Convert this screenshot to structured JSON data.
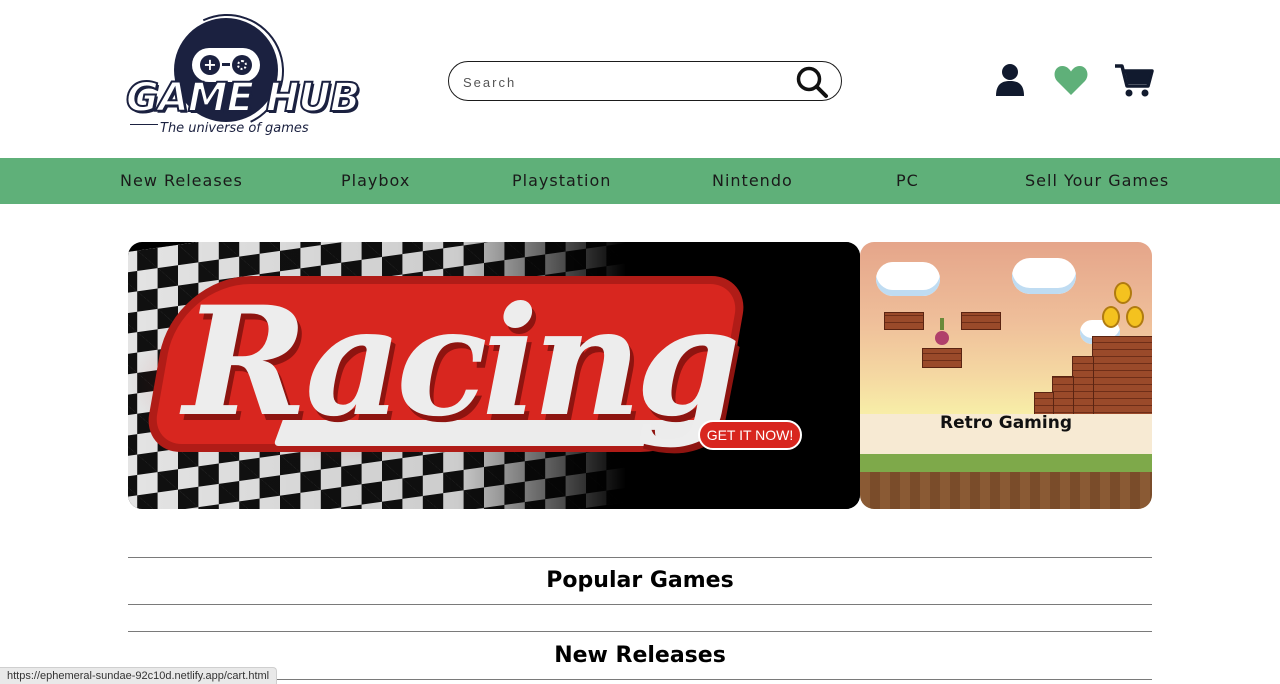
{
  "header": {
    "logo": {
      "title": "GAME HUB",
      "tagline": "The universe of games"
    },
    "search": {
      "placeholder": "Search",
      "value": ""
    },
    "icons": {
      "account": "user-icon",
      "wishlist": "heart-icon",
      "cart": "cart-icon"
    }
  },
  "nav": {
    "items": [
      {
        "label": "New Releases"
      },
      {
        "label": "Playbox"
      },
      {
        "label": "Playstation"
      },
      {
        "label": "Nintendo"
      },
      {
        "label": "PC"
      },
      {
        "label": "Sell Your Games"
      }
    ]
  },
  "banners": {
    "main": {
      "title": "Racing",
      "cta_label": "GET IT NOW!"
    },
    "side": {
      "label": "Retro Gaming"
    }
  },
  "sections": [
    {
      "title": "Popular Games"
    },
    {
      "title": "New Releases"
    }
  ],
  "status_bar": {
    "url": "https://ephemeral-sundae-92c10d.netlify.app/cart.html"
  },
  "colors": {
    "nav_bg": "#5fb079",
    "heart": "#5fb079",
    "brand_dark": "#1b2140",
    "cta_red": "#d8261f"
  }
}
